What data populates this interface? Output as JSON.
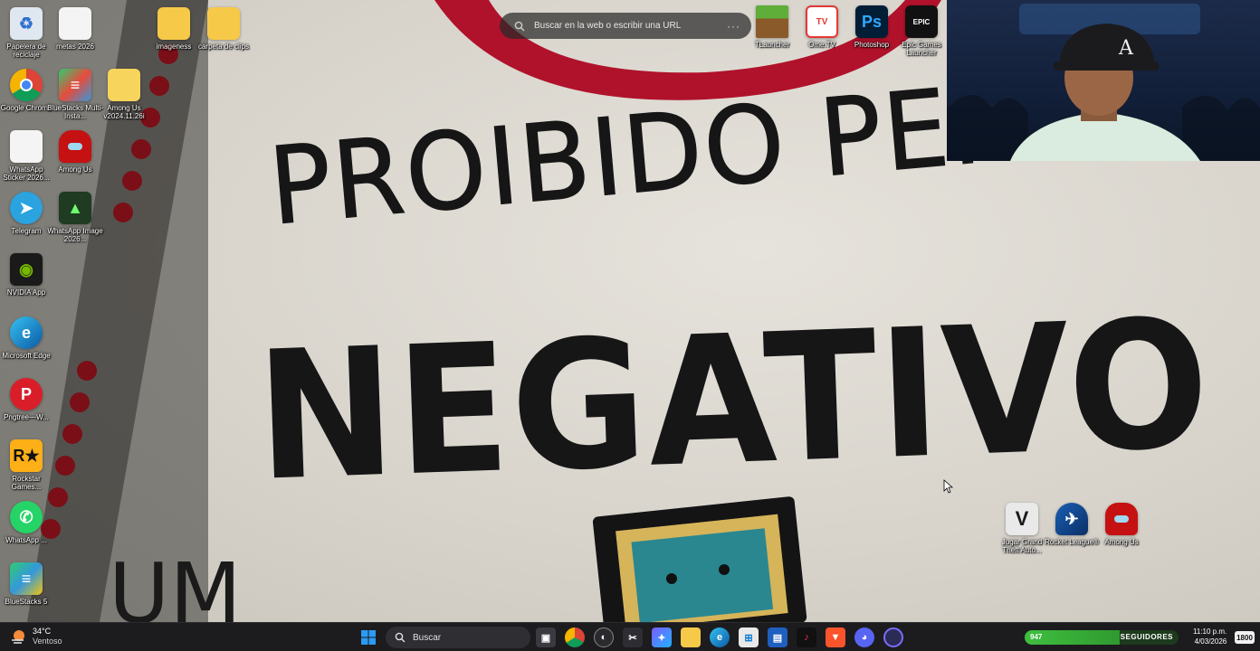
{
  "browser_search": {
    "placeholder": "Buscar en la web o escribir una URL",
    "menu": "···"
  },
  "wallpaper": {
    "line1": "PROIBIDO PENSAR",
    "line2": "NEGATIVO"
  },
  "desktop_icons": {
    "papelera": "Papelera de reciclaje",
    "metas": "metas 2026",
    "imageness": "imageness",
    "carpeta": "carpeta de clips",
    "chrome": "Google Chrome",
    "bluestacks_multi": "BlueStacks Multi-Insta...",
    "among_folder": "Among Us v2024.11.26i",
    "wa_sticker": "WhatsApp Sticker 2026...",
    "among_left": "Among Us",
    "telegram": "Telegram",
    "wa_image": "WhatsApp Image 2026...",
    "nvidia": "NVIDIA App",
    "edge": "Microsoft Edge",
    "pngtree": "Pngtree—W...",
    "rockstar": "Rockstar Games...",
    "whatsapp": "WhatsApp ...",
    "bluestacks5": "BlueStacks 5",
    "tlauncher": "TLauncher",
    "ometv": "Ome.TV",
    "photoshop": "Photoshop",
    "epic": "Epic Games Launcher",
    "gta": "Jugar Grand Theft Auto...",
    "rocket": "Rocket League®",
    "among_right": "Among Us"
  },
  "taskbar": {
    "weather_temp": "34°C",
    "weather_desc": "Ventoso",
    "search_label": "Buscar",
    "stream_value": "947",
    "stream_label": "SEGUIDORES",
    "stream_fraction": 0.62,
    "time": "11:10 p.m.",
    "date": "4/03/2026",
    "notif_count": "1800"
  },
  "colors": {
    "taskbar_bg": "#1c1c1f",
    "accent_blue": "#0078d4",
    "stream_green": "#3fbf3f"
  }
}
